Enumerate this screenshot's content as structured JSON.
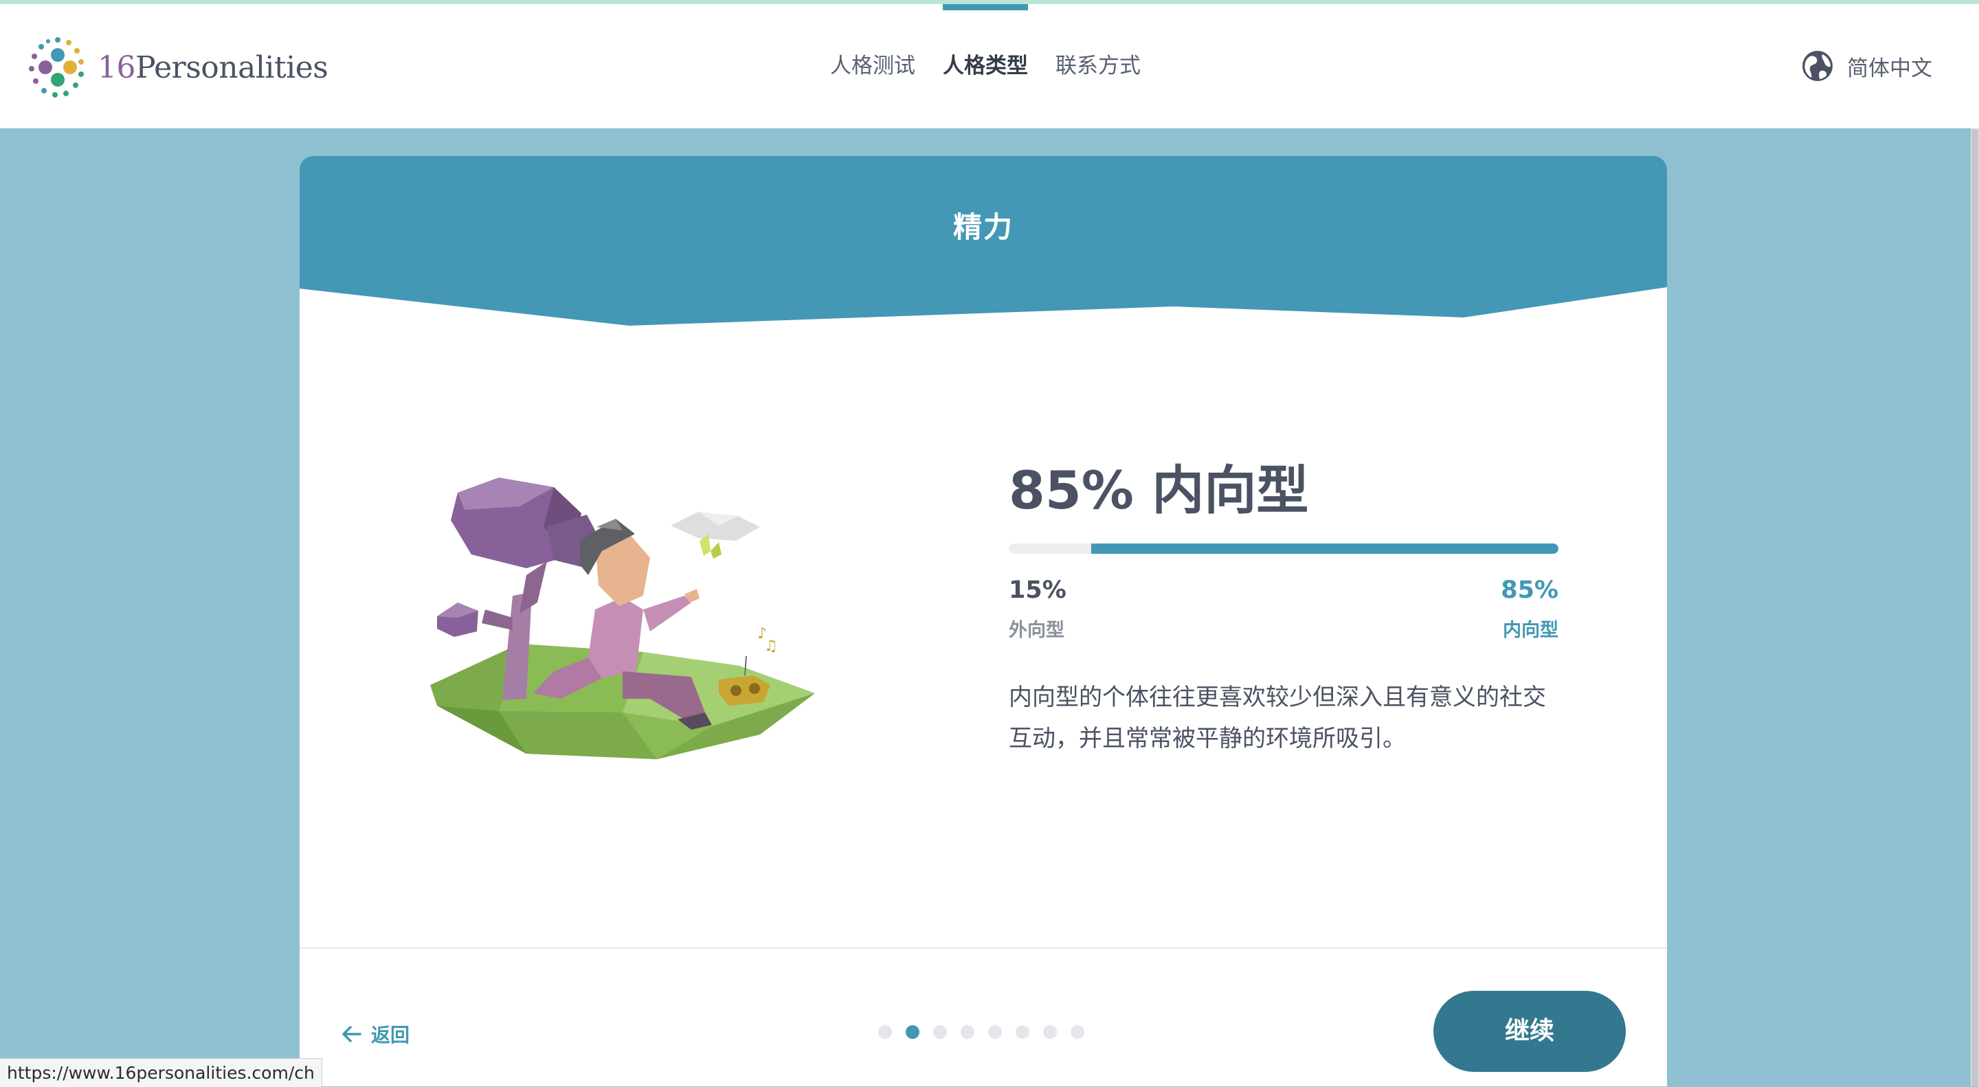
{
  "header": {
    "logo": {
      "number": "16",
      "word": "Personalities"
    },
    "nav": [
      {
        "label": "人格测试",
        "active": false
      },
      {
        "label": "人格类型",
        "active": true
      },
      {
        "label": "联系方式",
        "active": false
      }
    ],
    "language": {
      "label": "简体中文",
      "icon": "globe-icon"
    }
  },
  "card": {
    "title": "精力",
    "result_title": "85% 内向型",
    "bar": {
      "introvert_fraction": 0.85,
      "color": "#4298b4"
    },
    "left": {
      "percent": "15%",
      "label": "外向型"
    },
    "right": {
      "percent": "85%",
      "label": "内向型"
    },
    "description": "内向型的个体往往更喜欢较少但深入且有意义的社交互动，并且常常被平静的环境所吸引。",
    "illustration": "introvert-person-under-tree-illustration"
  },
  "footer_nav": {
    "back_label": "返回",
    "continue_label": "继续",
    "page_total": 8,
    "page_current": 2
  },
  "status_url": "https://www.16personalities.com/ch",
  "colors": {
    "accent": "#4298b4",
    "button": "#33788f",
    "background": "#8fc0d2",
    "text": "#4a5263"
  }
}
